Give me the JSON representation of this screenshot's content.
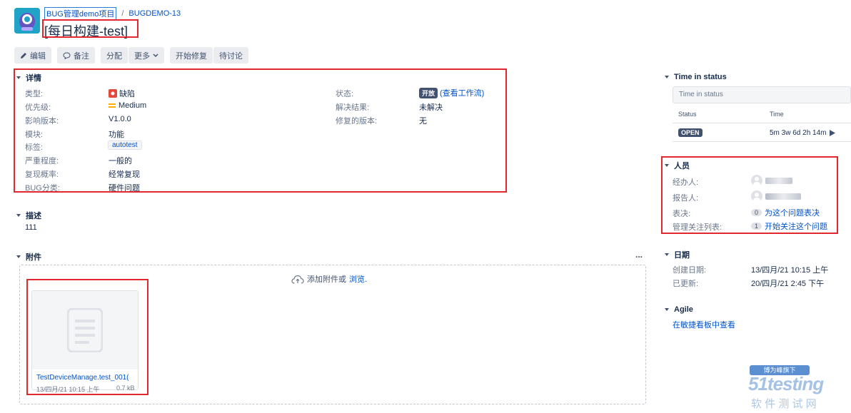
{
  "header": {
    "project_name": "BUG管理demo项目",
    "separator": "/",
    "issue_key": "BUGDEMO-13",
    "title": "[每日构建-test]"
  },
  "toolbar": {
    "edit": "编辑",
    "comment": "备注",
    "assign": "分配",
    "more": "更多",
    "start_fix": "开始修复",
    "discuss": "待讨论"
  },
  "details": {
    "heading": "详情",
    "left": [
      {
        "label": "类型:",
        "value": "缺陷"
      },
      {
        "label": "优先级:",
        "value": "Medium"
      },
      {
        "label": "影响版本:",
        "value": "V1.0.0"
      },
      {
        "label": "模块:",
        "value": "功能"
      },
      {
        "label": "标签:",
        "value": "autotest"
      },
      {
        "label": "严重程度:",
        "value": "一般的"
      },
      {
        "label": "复现概率:",
        "value": "经常复现"
      },
      {
        "label": "BUG分类:",
        "value": "硬件问题"
      }
    ],
    "right": [
      {
        "label": "状态:",
        "value": "开放",
        "extra": "(查看工作流)"
      },
      {
        "label": "解决结果:",
        "value": "未解决"
      },
      {
        "label": "修复的版本:",
        "value": "无"
      }
    ]
  },
  "description": {
    "heading": "描述",
    "text": "111"
  },
  "attachments": {
    "heading": "附件",
    "menu": "...",
    "drop_text": "添加附件或",
    "browse": "浏览.",
    "file_name": "TestDeviceManage.test_001(",
    "file_date": "13/四月/21 10:15 上午",
    "file_size": "0.7 kB"
  },
  "time_in_status": {
    "heading": "Time in status",
    "placeholder": "Time in status",
    "col_status": "Status",
    "col_time": "Time",
    "status": "OPEN",
    "time": "5m 3w 6d 2h 14m"
  },
  "people": {
    "heading": "人员",
    "assignee_label": "经办人:",
    "reporter_label": "报告人:",
    "votes_label": "表决:",
    "votes_count": "0",
    "votes_link": "为这个问题表决",
    "watchers_label": "管理关注列表:",
    "watchers_count": "1",
    "watchers_link": "开始关注这个问题"
  },
  "dates": {
    "heading": "日期",
    "created_label": "创建日期:",
    "created": "13/四月/21 10:15 上午",
    "updated_label": "已更新:",
    "updated": "20/四月/21 2:45 下午"
  },
  "agile": {
    "heading": "Agile",
    "link": "在敏捷看板中查看"
  },
  "watermark": {
    "badge": "博为峰旗下",
    "brand": "51testing",
    "sub": "软 件 测 试 网"
  }
}
